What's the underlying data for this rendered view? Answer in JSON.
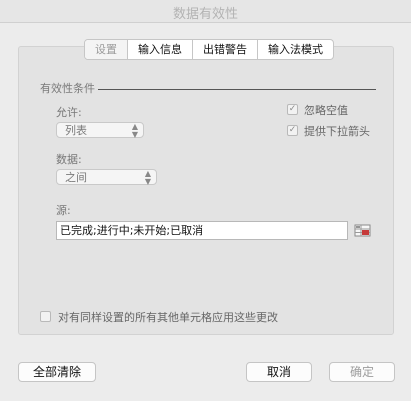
{
  "window": {
    "title": "数据有效性"
  },
  "tabs": [
    {
      "label": "设置"
    },
    {
      "label": "输入信息"
    },
    {
      "label": "出错警告"
    },
    {
      "label": "输入法模式"
    }
  ],
  "settings": {
    "section_title": "有效性条件",
    "allow_label": "允许:",
    "allow_value": "列表",
    "data_label": "数据:",
    "data_value": "之间",
    "ignore_blank_label": "忽略空值",
    "ignore_blank_checked": true,
    "dropdown_label": "提供下拉箭头",
    "dropdown_checked": true,
    "source_label": "源:",
    "source_value": "已完成;进行中;未开始;已取消",
    "apply_all_label": "对有同样设置的所有其他单元格应用这些更改",
    "apply_all_checked": false
  },
  "footer": {
    "clear_label": "全部清除",
    "cancel_label": "取消",
    "ok_label": "确定"
  },
  "icons": {
    "chevron": "up-down-chevron-icon",
    "checkmark": "checkmark-icon",
    "range": "range-select-icon"
  }
}
